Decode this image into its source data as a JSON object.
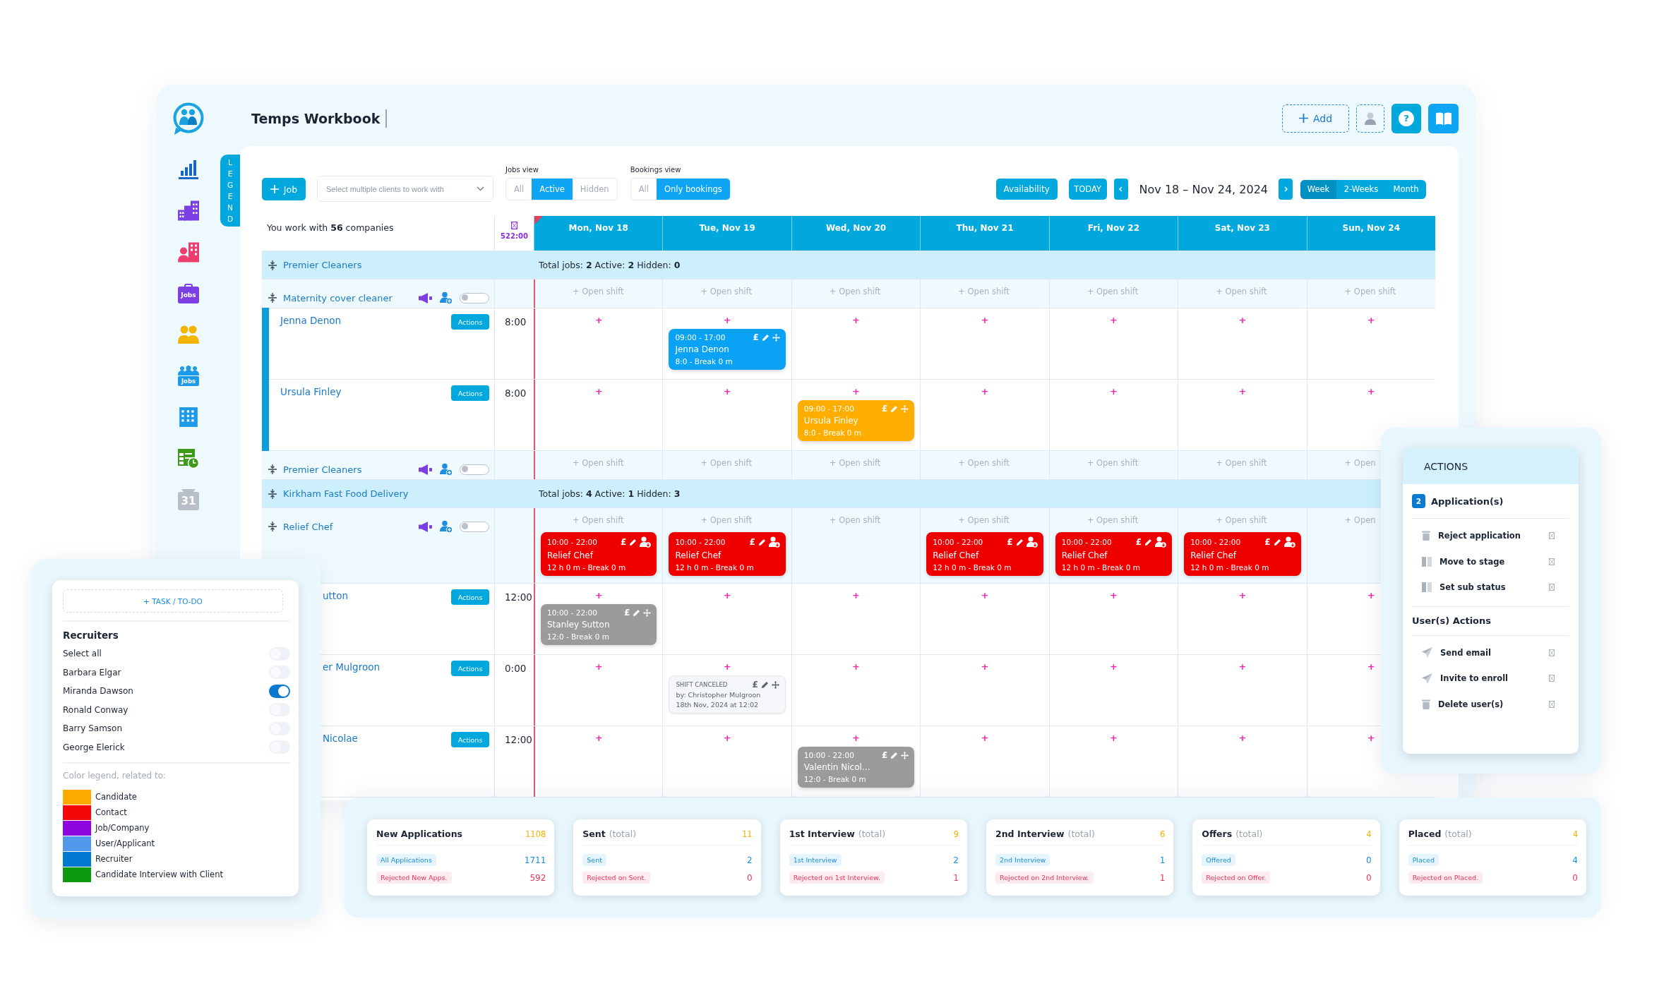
{
  "header": {
    "title": "Temps Workbook",
    "add_button": "Add",
    "help_button": "?"
  },
  "sidebar": {
    "items": [
      {
        "kind": "chart"
      },
      {
        "kind": "buildings"
      },
      {
        "kind": "contacts"
      },
      {
        "kind": "jobs",
        "text": "Jobs"
      },
      {
        "kind": "people"
      },
      {
        "kind": "people-jobs",
        "text": "Jobs"
      },
      {
        "kind": "grid"
      },
      {
        "kind": "sheet"
      },
      {
        "kind": "calendar",
        "text": "31"
      }
    ]
  },
  "legend_tab": {
    "label": "LEGEND"
  },
  "toolbar": {
    "job_button": "Job",
    "client_select": {
      "placeholder": "Select multiple clients to work with"
    },
    "jobs_view": {
      "label": "Jobs view",
      "options": [
        {
          "label": "All",
          "selected": false
        },
        {
          "label": "Active",
          "selected": true
        },
        {
          "label": "Hidden",
          "selected": false
        }
      ]
    },
    "bookings_view": {
      "label": "Bookings view",
      "options": [
        {
          "label": "All",
          "selected": false
        },
        {
          "label": "Only bookings",
          "selected": true
        }
      ]
    },
    "availability_button": "Availability",
    "today_button": "TODAY",
    "date_range": "Nov 18 – Nov 24, 2024",
    "range_options": [
      {
        "label": "Week",
        "selected": true
      },
      {
        "label": "2-Weeks",
        "selected": false
      },
      {
        "label": "Month",
        "selected": false
      }
    ]
  },
  "calendar": {
    "summary": "You work with **56** companies",
    "total_hours": "522:00",
    "days": [
      {
        "label": "Mon, Nov 18",
        "today": true
      },
      {
        "label": "Tue, Nov 19",
        "today": false
      },
      {
        "label": "Wed, Nov 20",
        "today": false
      },
      {
        "label": "Thu, Nov 21",
        "today": false
      },
      {
        "label": "Fri, Nov 22",
        "today": false
      },
      {
        "label": "Sat, Nov 23",
        "today": false
      },
      {
        "label": "Sun, Nov 24",
        "today": false
      }
    ],
    "rows": [
      {
        "kind": "company",
        "name": "Premier Cleaners",
        "summary": "Total jobs: **2** Active: **2** Hidden: **0**"
      },
      {
        "kind": "job",
        "name": "Maternity cover cleaner",
        "on": false,
        "cells": [
          {
            "open_shift": "+ Open shift"
          },
          {
            "open_shift": "+ Open shift"
          },
          {
            "open_shift": "+ Open shift"
          },
          {
            "open_shift": "+ Open shift"
          },
          {
            "open_shift": "+ Open shift"
          },
          {
            "open_shift": "+ Open shift"
          },
          {
            "open_shift": "+ Open shift"
          }
        ]
      },
      {
        "kind": "candidate",
        "name": "Jenna Denon",
        "action": "Actions",
        "hours": "8:00",
        "highlighted": true,
        "cells": [
          {
            "add": "+"
          },
          {
            "add": "+",
            "shifts": [
              {
                "kind": "booked",
                "color": "#0aa2f5",
                "time": "09:00 - 17:00",
                "name": "Jenna Denon",
                "detail": "8:0 - Break 0 m",
                "currency": "£"
              }
            ]
          },
          {
            "add": "+"
          },
          {
            "add": "+"
          },
          {
            "add": "+"
          },
          {
            "add": "+"
          },
          {
            "add": "+"
          }
        ]
      },
      {
        "kind": "candidate",
        "name": "Ursula Finley",
        "action": "Actions",
        "hours": "8:00",
        "highlighted": true,
        "cells": [
          {
            "add": "+"
          },
          {
            "add": "+"
          },
          {
            "add": "+",
            "shifts": [
              {
                "kind": "booked",
                "color": "#ffae00",
                "time": "09:00 - 17:00",
                "name": "Ursula Finley",
                "detail": "8:0 - Break 0 m",
                "currency": "£"
              }
            ]
          },
          {
            "add": "+"
          },
          {
            "add": "+"
          },
          {
            "add": "+"
          },
          {
            "add": "+"
          }
        ]
      },
      {
        "kind": "job",
        "name": "Premier Cleaners",
        "on": false,
        "cells": [
          {
            "open_shift": "+ Open shift"
          },
          {
            "open_shift": "+ Open shift"
          },
          {
            "open_shift": "+ Open shift"
          },
          {
            "open_shift": "+ Open shift"
          },
          {
            "open_shift": "+ Open shift"
          },
          {
            "open_shift": "+ Open shift"
          },
          {
            "open_shift": "+ Open"
          }
        ]
      },
      {
        "kind": "company",
        "name": "Kirkham Fast Food Delivery",
        "summary": "Total jobs: **4** Active: **1** Hidden: **3**"
      },
      {
        "kind": "job",
        "name": "Relief Chef",
        "on": false,
        "cells": [
          {
            "open_shift": "+ Open shift",
            "shifts": [
              {
                "kind": "open",
                "color": "#ef0000",
                "time": "10:00 - 22:00",
                "name": "Relief Chef",
                "detail": "12 h 0 m - Break 0 m",
                "currency": "£"
              }
            ]
          },
          {
            "open_shift": "+ Open shift",
            "shifts": [
              {
                "kind": "open",
                "color": "#ef0000",
                "time": "10:00 - 22:00",
                "name": "Relief Chef",
                "detail": "12 h 0 m - Break 0 m",
                "currency": "£"
              }
            ]
          },
          {
            "open_shift": "+ Open shift"
          },
          {
            "open_shift": "+ Open shift",
            "shifts": [
              {
                "kind": "open",
                "color": "#ef0000",
                "time": "10:00 - 22:00",
                "name": "Relief Chef",
                "detail": "12 h 0 m - Break 0 m",
                "currency": "£"
              }
            ]
          },
          {
            "open_shift": "+ Open shift",
            "shifts": [
              {
                "kind": "open",
                "color": "#ef0000",
                "time": "10:00 - 22:00",
                "name": "Relief Chef",
                "detail": "12 h 0 m - Break 0 m",
                "currency": "£"
              }
            ]
          },
          {
            "open_shift": "+ Open shift",
            "shifts": [
              {
                "kind": "open",
                "color": "#ef0000",
                "time": "10:00 - 22:00",
                "name": "Relief Chef",
                "detail": "12 h 0 m - Break 0 m",
                "currency": "£"
              }
            ]
          },
          {
            "open_shift": "+ Open"
          }
        ]
      },
      {
        "kind": "candidate",
        "name": "utton",
        "action": "Actions",
        "hours": "12:00",
        "cells": [
          {
            "add": "+",
            "shifts": [
              {
                "kind": "booked",
                "color": "#9b9b9b",
                "time": "10:00 - 22:00",
                "name": "Stanley Sutton",
                "detail": "12:0 - Break 0 m",
                "currency": "£"
              }
            ]
          },
          {
            "add": "+"
          },
          {
            "add": "+"
          },
          {
            "add": "+"
          },
          {
            "add": "+"
          },
          {
            "add": "+"
          },
          {
            "add": "+"
          }
        ]
      },
      {
        "kind": "candidate",
        "name": "er Mulgroon",
        "action": "Actions",
        "hours": "0:00",
        "cells": [
          {
            "add": "+"
          },
          {
            "add": "+",
            "shifts": [
              {
                "kind": "canceled",
                "status": "SHIFT CANCELED",
                "by": "by: Christopher Mulgroon",
                "when": "18th Nov, 2024 at 12:02",
                "currency": "£"
              }
            ]
          },
          {
            "add": "+"
          },
          {
            "add": "+"
          },
          {
            "add": "+"
          },
          {
            "add": "+"
          },
          {
            "add": "+"
          }
        ]
      },
      {
        "kind": "candidate",
        "name": "Nicolae",
        "action": "Actions",
        "hours": "12:00",
        "cells": [
          {
            "add": "+"
          },
          {
            "add": "+"
          },
          {
            "add": "+",
            "shifts": [
              {
                "kind": "booked",
                "color": "#9b9b9b",
                "time": "10:00 - 22:00",
                "name": "Valentin Nicol…",
                "detail": "12:0 - Break 0 m",
                "currency": "£"
              }
            ]
          },
          {
            "add": "+"
          },
          {
            "add": "+"
          },
          {
            "add": "+"
          },
          {
            "add": "+"
          }
        ]
      }
    ]
  },
  "recruiters_panel": {
    "task_button": "+ TASK / TO-DO",
    "title": "Recruiters",
    "items": [
      {
        "name": "Select all",
        "on": false
      },
      {
        "name": "Barbara Elgar",
        "on": false
      },
      {
        "name": "Miranda Dawson",
        "on": true
      },
      {
        "name": "Ronald Conway",
        "on": false
      },
      {
        "name": "Barry Samson",
        "on": false
      },
      {
        "name": "George Elerick",
        "on": false
      }
    ],
    "legend_title": "Color legend, related to:",
    "legend": [
      {
        "label": "Candidate",
        "color": "#ffaa00"
      },
      {
        "label": "Contact",
        "color": "#f5080a"
      },
      {
        "label": "Job/Company",
        "color": "#8e05df"
      },
      {
        "label": "User/Applicant",
        "color": "#5298ec"
      },
      {
        "label": "Recruiter",
        "color": "#0078d0"
      },
      {
        "label": "Candidate Interview with Client",
        "color": "#0e9a0e"
      }
    ]
  },
  "actions_panel": {
    "title": "ACTIONS",
    "count": "2",
    "section": "Application(s)",
    "items": [
      {
        "kind": "trash",
        "label": "Reject application"
      },
      {
        "kind": "columns",
        "label": "Move to stage"
      },
      {
        "kind": "columns",
        "label": "Set sub status"
      }
    ],
    "user_section": "User(s) Actions",
    "user_items": [
      {
        "kind": "send",
        "label": "Send email"
      },
      {
        "kind": "send",
        "label": "Invite to enroll"
      },
      {
        "kind": "trash",
        "label": "Delete user(s)"
      }
    ]
  },
  "stats": {
    "cards": [
      {
        "title": "New Applications",
        "total": "1108",
        "rows": [
          {
            "kind": "passed",
            "label": "All Applications",
            "value": "1711"
          },
          {
            "kind": "rejected",
            "label": "Rejected New Apps.",
            "value": "592"
          }
        ]
      },
      {
        "title": "Sent",
        "note": "(total)",
        "total": "11",
        "rows": [
          {
            "kind": "passed",
            "label": "Sent",
            "value": "2"
          },
          {
            "kind": "rejected",
            "label": "Rejected on Sent.",
            "value": "0"
          }
        ]
      },
      {
        "title": "1st Interview",
        "note": "(total)",
        "total": "9",
        "rows": [
          {
            "kind": "passed",
            "label": "1st Interview",
            "value": "2"
          },
          {
            "kind": "rejected",
            "label": "Rejected on 1st Interview.",
            "value": "1"
          }
        ]
      },
      {
        "title": "2nd Interview",
        "note": "(total)",
        "total": "6",
        "rows": [
          {
            "kind": "passed",
            "label": "2nd Interview",
            "value": "1"
          },
          {
            "kind": "rejected",
            "label": "Rejected on 2nd Interview.",
            "value": "1"
          }
        ]
      },
      {
        "title": "Offers",
        "note": "(total)",
        "total": "4",
        "rows": [
          {
            "kind": "passed",
            "label": "Offered",
            "value": "0"
          },
          {
            "kind": "rejected",
            "label": "Rejected on Offer.",
            "value": "0"
          }
        ]
      },
      {
        "title": "Placed",
        "note": "(total)",
        "total": "4",
        "rows": [
          {
            "kind": "passed",
            "label": "Placed",
            "value": "4"
          },
          {
            "kind": "rejected",
            "label": "Rejected on Placed.",
            "value": "0"
          }
        ]
      }
    ]
  }
}
